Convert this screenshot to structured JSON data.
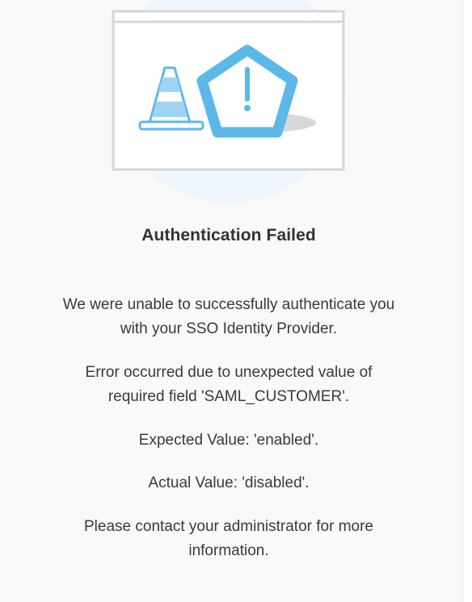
{
  "colors": {
    "accent": "#5bb8e8",
    "accent_light": "#9fd3f3",
    "frame": "#d6d6d6",
    "halo": "#eef5fc",
    "background": "#f9f9f9"
  },
  "illustration": {
    "icons": [
      "traffic-cone-icon",
      "warning-pentagon-icon"
    ]
  },
  "error": {
    "title": "Authentication Failed",
    "message_line1": "We were unable to successfully authenticate you",
    "message_line2": "with your SSO Identity Provider.",
    "detail_line1": "Error occurred due to unexpected value of",
    "detail_line2": "required field 'SAML_CUSTOMER'.",
    "expected": "Expected Value: 'enabled'.",
    "actual": "Actual Value: 'disabled'.",
    "contact_line1": "Please contact your administrator for more",
    "contact_line2": "information."
  }
}
